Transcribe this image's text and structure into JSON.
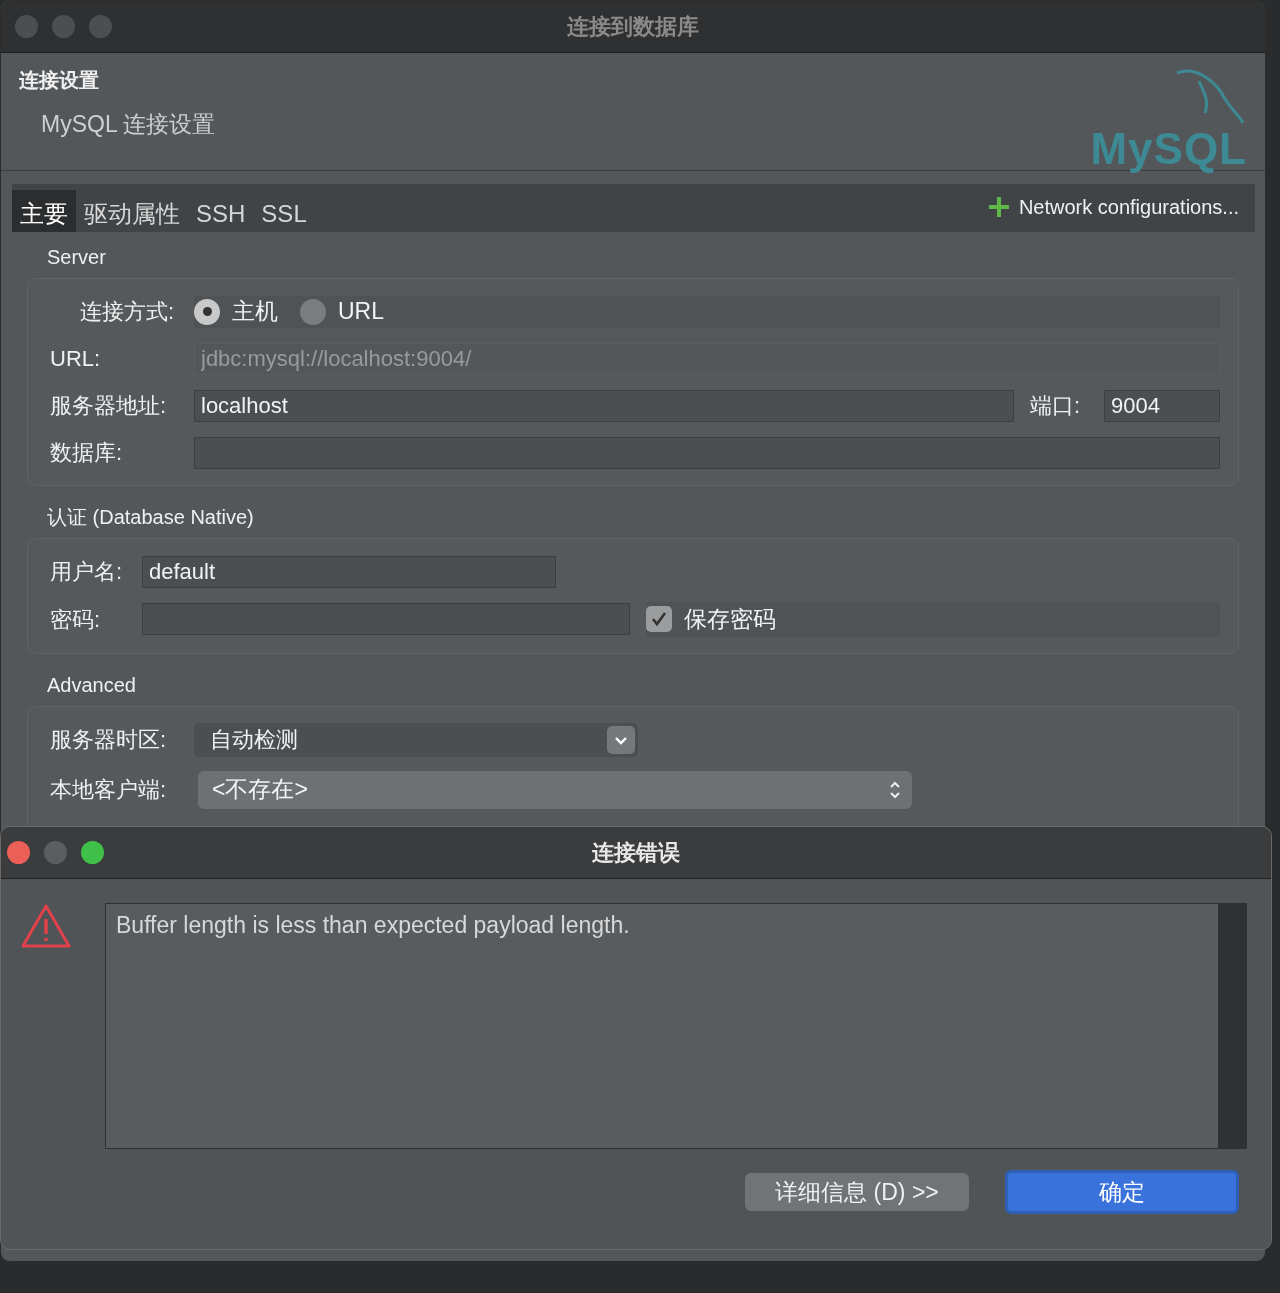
{
  "window": {
    "title": "连接到数据库"
  },
  "header": {
    "title": "连接设置",
    "subtitle": "MySQL 连接设置",
    "logo": "MySQL"
  },
  "tabs": [
    {
      "label": "主要",
      "selected": true
    },
    {
      "label": "驱动属性",
      "selected": false
    },
    {
      "label": "SSH",
      "selected": false
    },
    {
      "label": "SSL",
      "selected": false
    }
  ],
  "network_button": "Network configurations...",
  "server": {
    "title": "Server",
    "connect_mode": {
      "label": "连接方式:",
      "options": [
        {
          "label": "主机",
          "selected": true
        },
        {
          "label": "URL",
          "selected": false
        }
      ]
    },
    "url": {
      "label": "URL:",
      "value": "jdbc:mysql://localhost:9004/",
      "disabled": true
    },
    "host": {
      "label": "服务器地址:",
      "value": "localhost"
    },
    "port": {
      "label": "端口:",
      "value": "9004"
    },
    "database": {
      "label": "数据库:"
    }
  },
  "auth": {
    "title": "认证 (Database Native)",
    "username": {
      "label": "用户名:",
      "value": "default"
    },
    "password": {
      "label": "密码:"
    },
    "save_password": {
      "label": "保存密码",
      "checked": true
    }
  },
  "advanced": {
    "title": "Advanced",
    "timezone": {
      "label": "服务器时区:",
      "value": "自动检测"
    },
    "local_client": {
      "label": "本地客户端:",
      "value": "<不存在>"
    }
  },
  "error_dialog": {
    "title": "连接错误",
    "message": "Buffer length is less than expected payload length.",
    "buttons": [
      {
        "label": "详细信息 (D) >>",
        "primary": false
      },
      {
        "label": "确定",
        "primary": true
      }
    ]
  }
}
